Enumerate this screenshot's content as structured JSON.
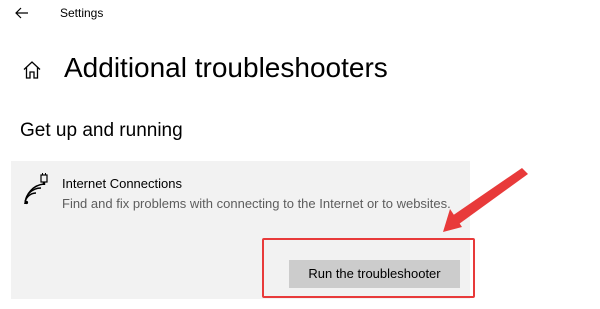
{
  "window": {
    "app_title": "Settings",
    "back_icon": "back-arrow-icon"
  },
  "page": {
    "home_icon": "home-icon",
    "title": "Additional troubleshooters"
  },
  "section": {
    "heading": "Get up and running"
  },
  "troubleshooter": {
    "icon": "wifi-ethernet-icon",
    "title": "Internet Connections",
    "description": "Find and fix problems with connecting to the Internet or to websites.",
    "run_button": "Run the troubleshooter"
  },
  "annotation": {
    "color": "#e83a3a"
  }
}
